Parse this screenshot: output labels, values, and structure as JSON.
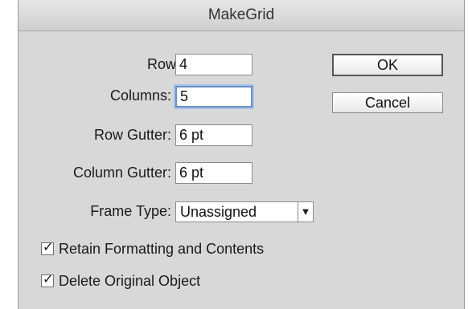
{
  "window": {
    "title": "MakeGrid"
  },
  "form": {
    "rows": {
      "label": "Rows:",
      "value": "4"
    },
    "columns": {
      "label": "Columns:",
      "value": "5"
    },
    "row_gutter": {
      "label": "Row Gutter:",
      "value": "6 pt"
    },
    "column_gutter": {
      "label": "Column Gutter:",
      "value": "6 pt"
    },
    "frame_type": {
      "label": "Frame Type:",
      "value": "Unassigned"
    }
  },
  "buttons": {
    "ok": "OK",
    "cancel": "Cancel"
  },
  "options": {
    "retain": {
      "label": "Retain Formatting and Contents",
      "checked": true
    },
    "delete_original": {
      "label": "Delete Original Object",
      "checked": true
    }
  },
  "icons": {
    "dropdown": "triangle-down-icon",
    "checkmark": "checkmark-icon"
  },
  "colors": {
    "dialog_bg": "#d8d8d8",
    "focus_ring": "#6a8fc6"
  }
}
